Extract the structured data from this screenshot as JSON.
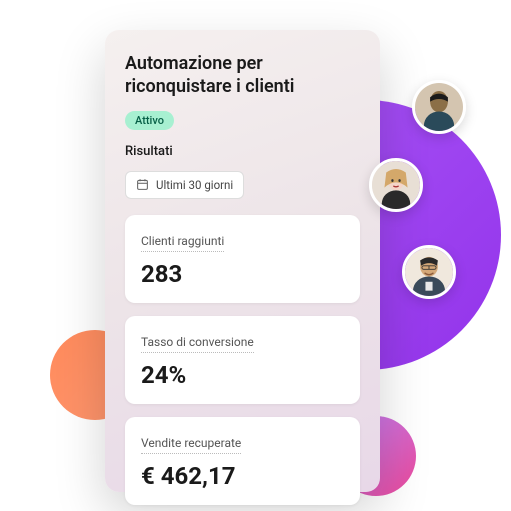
{
  "card": {
    "title": "Automazione per riconquistare i clienti",
    "status_badge": "Attivo",
    "section_label": "Risultati",
    "date_range": "Ultimi 30 giorni"
  },
  "stats": [
    {
      "label": "Clienti raggiunti",
      "value": "283"
    },
    {
      "label": "Tasso di conversione",
      "value": "24%"
    },
    {
      "label": "Vendite recuperate",
      "value": "€ 462,17"
    }
  ]
}
